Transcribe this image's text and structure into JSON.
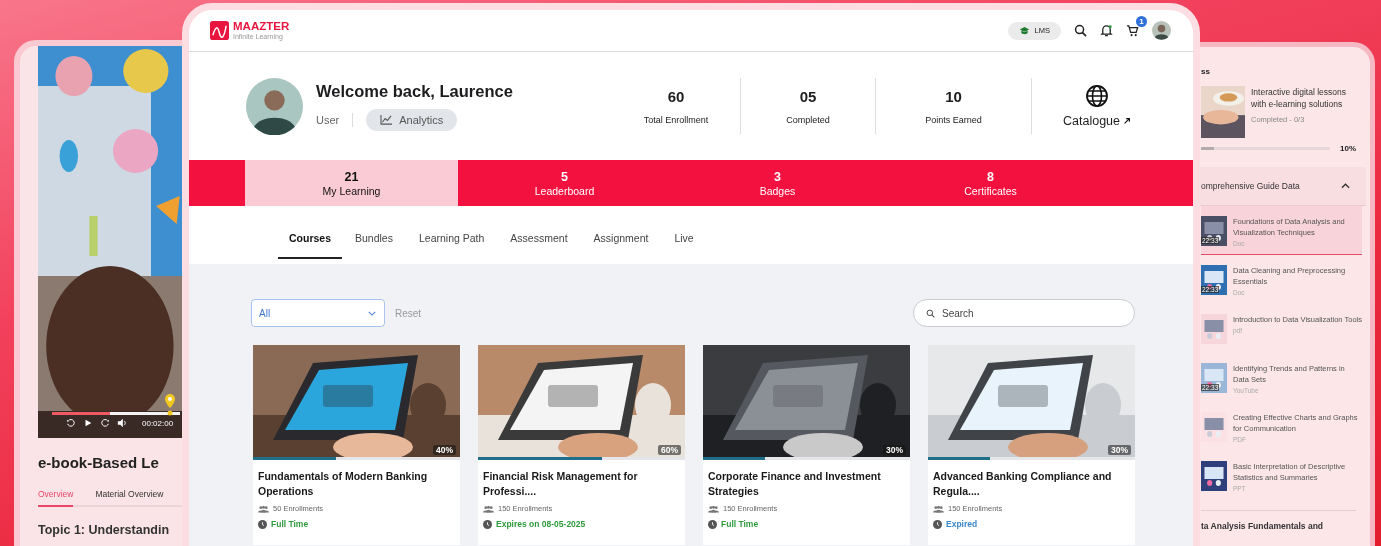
{
  "left_panel": {
    "video": {
      "time": "00:02:00",
      "level": 0.45
    },
    "title": "e-book-Based Le",
    "tabs": [
      {
        "label": "Overview",
        "selected": true
      },
      {
        "label": "Material Overview",
        "selected": false
      }
    ],
    "topic": "Topic 1: Understandin"
  },
  "header": {
    "logo": {
      "name": "MAAZTER",
      "tagline": "Infinite Learning"
    },
    "mode_chip": "LMS",
    "cart_count": "1"
  },
  "profile": {
    "greeting": "Welcome back, Laurence",
    "role": "User",
    "analytics_button": "Analytics",
    "stats": [
      {
        "value": "60",
        "label": "Total Enrollment"
      },
      {
        "value": "05",
        "label": "Completed"
      },
      {
        "value": "10",
        "label": "Points Earned"
      }
    ],
    "catalogue": "Catalogue"
  },
  "summary_tabs": [
    {
      "count": "21",
      "label": "My Learning",
      "selected": true
    },
    {
      "count": "5",
      "label": "Leaderboard",
      "selected": false
    },
    {
      "count": "3",
      "label": "Badges",
      "selected": false
    },
    {
      "count": "8",
      "label": "Certificates",
      "selected": false
    }
  ],
  "course_tabs": [
    {
      "label": "Courses",
      "selected": true
    },
    {
      "label": "Bundles",
      "selected": false
    },
    {
      "label": "Learning Path",
      "selected": false
    },
    {
      "label": "Assessment",
      "selected": false
    },
    {
      "label": "Assignment",
      "selected": false
    },
    {
      "label": "Live",
      "selected": false
    }
  ],
  "filters": {
    "category": "All",
    "reset": "Reset",
    "search_placeholder": "Search"
  },
  "courses": [
    {
      "title": "Fundamentals of Modern Banking Operations",
      "progress": "40%",
      "level": 0.4,
      "enrollments": "50 Enrollments",
      "status": "Full Time",
      "color": "#2f9a3c"
    },
    {
      "title": "Financial Risk Management for Professi....",
      "progress": "60%",
      "level": 0.6,
      "enrollments": "150 Enrollments",
      "status": "Expires on 08-05-2025",
      "color": "#2f9a3c"
    },
    {
      "title": "Corporate Finance and Investment Strategies",
      "progress": "30%",
      "level": 0.3,
      "enrollments": "150 Enrollments",
      "status": "Full Time",
      "color": "#2f9a3c"
    },
    {
      "title": "Advanced Banking Compliance and Regula....",
      "progress": "30%",
      "level": 0.3,
      "enrollments": "150 Enrollments",
      "status": "Expired",
      "color": "#3b86c8"
    }
  ],
  "right_panel": {
    "heading": "ss",
    "course": {
      "title": "Interactive digital lessons with e-learning solutions",
      "completed": "Completed - 0/3",
      "level": 0.1,
      "percent": "10%"
    },
    "section": {
      "title": "omprehensive Guide Data",
      "expanded": true,
      "items": [
        {
          "title": "Foundations of Data Analysis and Visualization Techniques",
          "type": "Doc",
          "duration": "22:33",
          "selected": true
        },
        {
          "title": "Data Cleaning and Preprocessing Essentials",
          "type": "Doc",
          "duration": "22:33",
          "selected": false
        },
        {
          "title": "Introduction to Data Visualization Tools",
          "type": "pdf",
          "selected": false
        },
        {
          "title": "Identifying Trends and Patterns in Data Sets",
          "type": "YouTube",
          "duration": "22:33",
          "selected": false
        },
        {
          "title": "Creating Effective Charts and Graphs for Communication",
          "type": "PDF",
          "selected": false
        },
        {
          "title": "Basic Interpretation of Descriptive Statistics and Summaries",
          "type": "PPT",
          "selected": false
        }
      ]
    },
    "next_section": "ta Analysis Fundamentals and"
  }
}
